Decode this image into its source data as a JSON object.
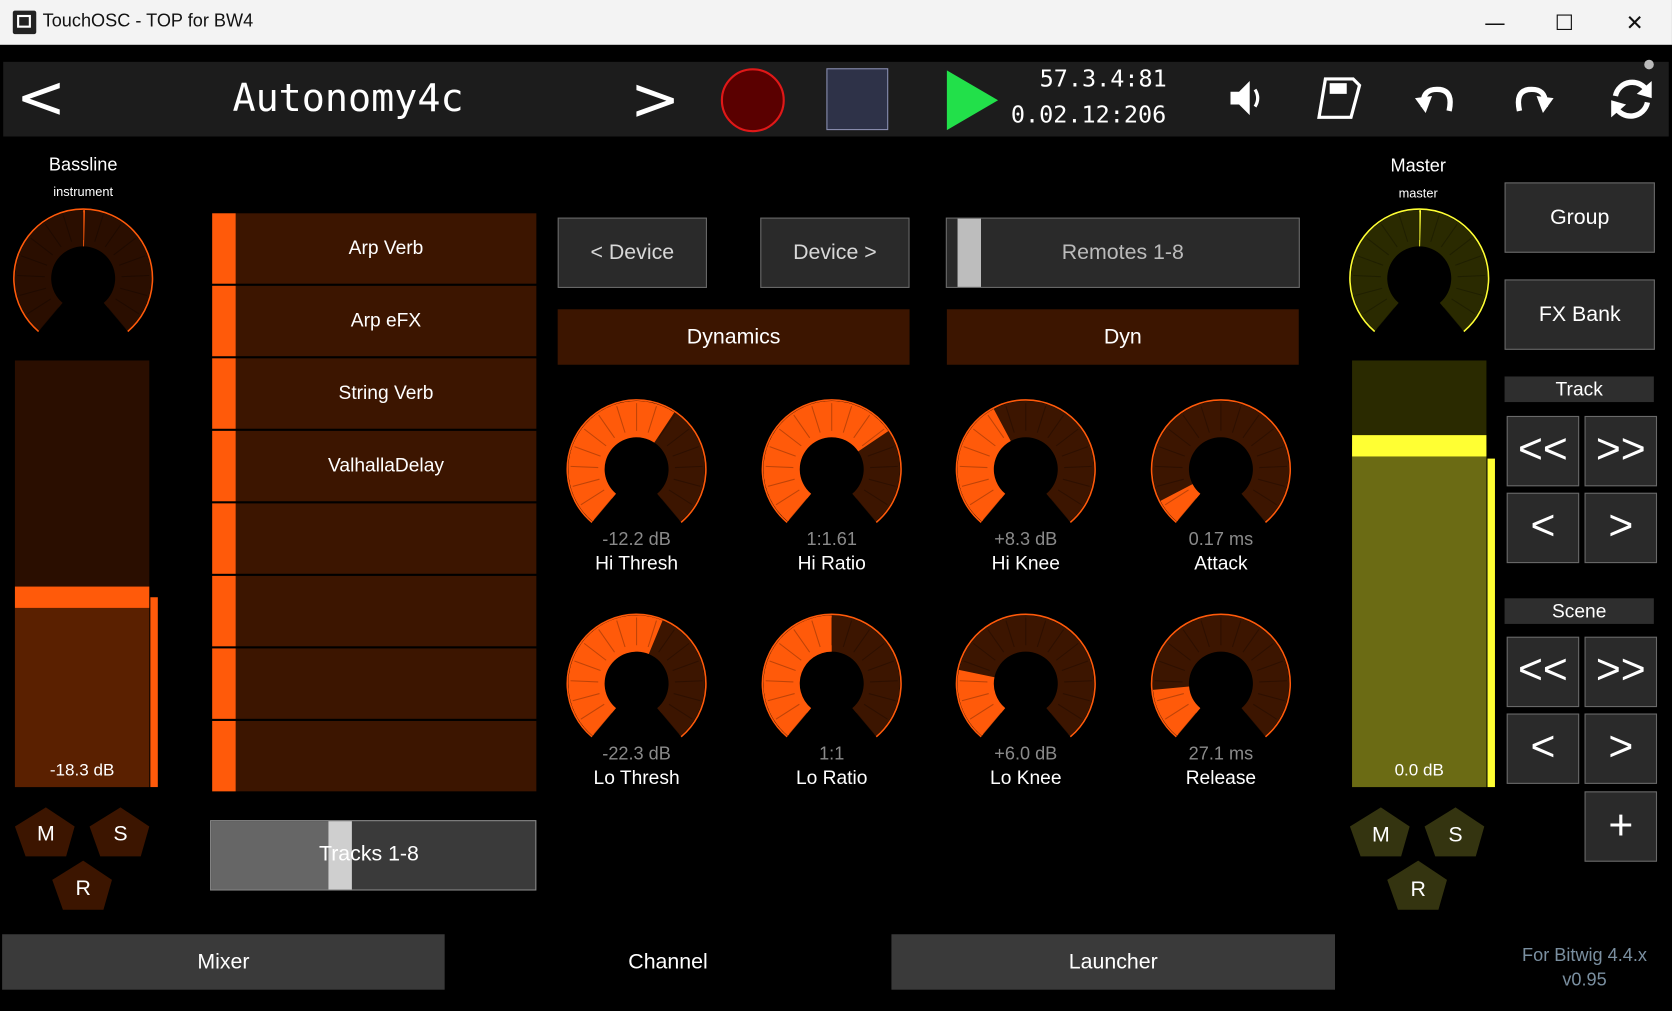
{
  "window": {
    "title": "TouchOSC - TOP for BW4",
    "minimize": "—",
    "maximize": "☐",
    "close": "✕"
  },
  "toolbar": {
    "prev": "<",
    "next": ">",
    "project_name": "Autonomy4c",
    "position_bars": "57.3.4:81",
    "position_time": "0.02.12:206",
    "record_color": "#5a0000",
    "play_color": "#22e04a"
  },
  "left_channel": {
    "name": "Bassline",
    "type": "instrument",
    "volume_text": "-18.3 dB",
    "volume_level": 0.42,
    "pan_position": 0.5,
    "color": "#ff5a0a",
    "mute": "M",
    "solo": "S",
    "rec": "R"
  },
  "devices": [
    {
      "label": "Arp Verb"
    },
    {
      "label": "Arp eFX"
    },
    {
      "label": "String Verb"
    },
    {
      "label": "ValhallaDelay"
    },
    {
      "label": ""
    },
    {
      "label": ""
    },
    {
      "label": ""
    },
    {
      "label": ""
    }
  ],
  "tracks_bank": {
    "label": "Tracks 1-8"
  },
  "device_nav": {
    "prev": "< Device",
    "next": "Device >",
    "remotes": "Remotes 1-8"
  },
  "device_name": "Dynamics",
  "page_name": "Dyn",
  "knobs": [
    {
      "value": "-12.2 dB",
      "name": "Hi Thresh",
      "level": 0.62
    },
    {
      "value": "1:1.61",
      "name": "Hi Ratio",
      "level": 0.7
    },
    {
      "value": "+8.3 dB",
      "name": "Hi Knee",
      "level": 0.4
    },
    {
      "value": "0.17 ms",
      "name": "Attack",
      "level": 0.08
    },
    {
      "value": "-22.3 dB",
      "name": "Lo Thresh",
      "level": 0.58
    },
    {
      "value": "1:1",
      "name": "Lo Ratio",
      "level": 0.5
    },
    {
      "value": "+6.0 dB",
      "name": "Lo Knee",
      "level": 0.22
    },
    {
      "value": "27.1 ms",
      "name": "Release",
      "level": 0.16
    }
  ],
  "master": {
    "name": "Master",
    "type": "master",
    "volume_text": "0.0 dB",
    "volume_level": 0.8,
    "pan_position": 0.5,
    "color": "#ffff33",
    "mute": "M",
    "solo": "S",
    "rec": "R"
  },
  "right_panel": {
    "group": "Group",
    "fx_bank": "FX Bank",
    "track_label": "Track",
    "scene_label": "Scene",
    "page_back": "<<",
    "page_fwd": ">>",
    "back": "<",
    "fwd": ">",
    "add": "+"
  },
  "tabs": {
    "mixer": "Mixer",
    "channel": "Channel",
    "launcher": "Launcher"
  },
  "footer": {
    "line1": "For Bitwig 4.4.x",
    "line2": "v0.95"
  }
}
